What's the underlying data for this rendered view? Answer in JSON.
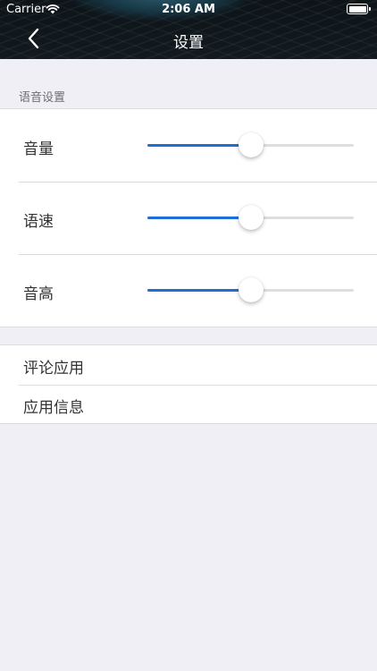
{
  "status_bar": {
    "carrier": "Carrier",
    "time": "2:06 AM",
    "wifi_icon": "wifi-icon",
    "battery_icon": "battery-icon"
  },
  "nav": {
    "title": "设置",
    "back_icon": "chevron-left-icon"
  },
  "voice_settings": {
    "header": "语音设置",
    "sliders": [
      {
        "label": "音量",
        "value": 0.5
      },
      {
        "label": "语速",
        "value": 0.5
      },
      {
        "label": "音高",
        "value": 0.5
      }
    ]
  },
  "links": [
    {
      "label": "评论应用"
    },
    {
      "label": "应用信息"
    }
  ],
  "colors": {
    "accent": "#1f6fd6",
    "background": "#f0eff5",
    "track": "#dedede"
  }
}
